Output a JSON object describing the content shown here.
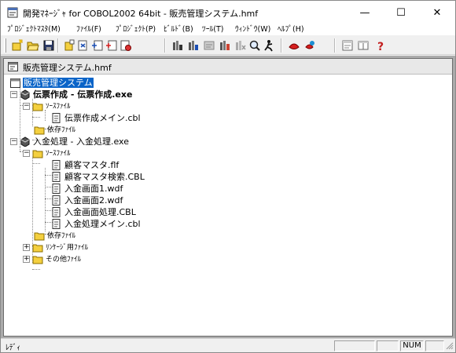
{
  "window": {
    "title": "開発ﾏﾈｰｼﾞｬ for COBOL2002 64bit - 販売管理システム.hmf",
    "minimize": "—",
    "maximize": "☐",
    "close": "✕"
  },
  "menu": [
    "ﾌﾟﾛｼﾞｪｸﾄﾏｽﾀ(M)",
    "ﾌｧｲﾙ(F)",
    "ﾌﾟﾛｼﾞｪｸﾄ(P)",
    "ﾋﾞﾙﾄﾞ(B)",
    "ﾂｰﾙ(T)",
    "ｳｨﾝﾄﾞｳ(W)",
    "ﾍﾙﾌﾟ(H)"
  ],
  "toolbar": {
    "icons": [
      "new-project-icon",
      "open-project-icon",
      "save-icon",
      "add-file-icon",
      "remove-file-icon",
      "add-source-icon",
      "add-dependency-icon",
      "properties-icon",
      "build-icon",
      "rebuild-icon",
      "compile-icon",
      "link-icon",
      "clean-icon",
      "find-icon",
      "debug-icon",
      "run-icon",
      "test-icon",
      "window-list-icon",
      "tile-icon",
      "help-icon"
    ]
  },
  "child_window": {
    "title": "販売管理システム.hmf"
  },
  "tree": {
    "root": "販売管理システム",
    "targets": [
      {
        "label": "伝票作成 - 伝票作成.exe",
        "source_folder": "ｿｰｽﾌｧｲﾙ",
        "sources": [
          "伝票作成メイン.cbl"
        ],
        "dependency_folder": "依存ﾌｧｲﾙ"
      },
      {
        "label": "入金処理 - 入金処理.exe",
        "source_folder": "ｿｰｽﾌｧｲﾙ",
        "sources": [
          "顧客マスタ.flf",
          "顧客マスタ検索.CBL",
          "入金画面1.wdf",
          "入金画面2.wdf",
          "入金画面処理.CBL",
          "入金処理メイン.cbl"
        ],
        "dependency_folder": "依存ﾌｧｲﾙ"
      }
    ],
    "extra_folders": [
      "ﾘﾝｹｰｼﾞ用ﾌｧｲﾙ",
      "その他ﾌｧｲﾙ"
    ]
  },
  "status": {
    "text": "ﾚﾃﾞｨ",
    "num": "NUM"
  },
  "colors": {
    "selection": "#0a64c8",
    "folder": "#f4d03f",
    "title_bar": "#ffffff"
  }
}
